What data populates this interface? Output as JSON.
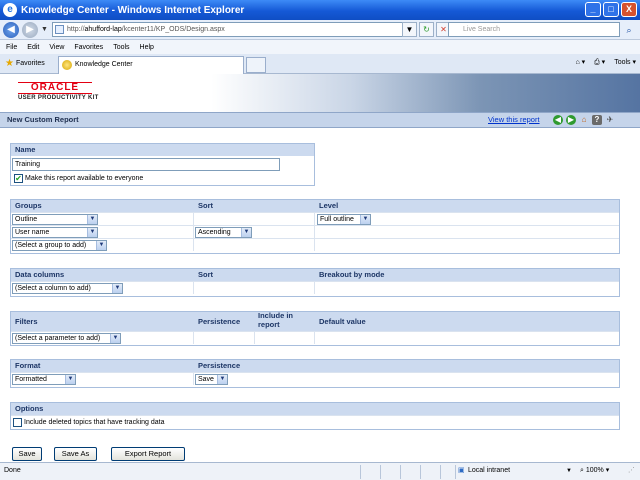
{
  "window": {
    "title": "Knowledge Center - Windows Internet Explorer",
    "controls": {
      "minimize": "_",
      "maximize": "□",
      "close": "X"
    }
  },
  "address_bar": {
    "url_prefix": "http://",
    "url_host": "ahufford-lap",
    "url_path": "/kcenter11/KP_ODS/Design.aspx",
    "search_placeholder": "Live Search"
  },
  "menu": [
    "File",
    "Edit",
    "View",
    "Favorites",
    "Tools",
    "Help"
  ],
  "favorites_bar": {
    "favorites_label": "Favorites",
    "tab_label": "Knowledge Center",
    "tools_label": "Tools"
  },
  "banner": {
    "logo_text": "ORACLE",
    "logo_subtext": "USER PRODUCTIVITY KIT"
  },
  "page_header": {
    "title": "New Custom Report",
    "view_link": "View this report"
  },
  "name_section": {
    "header": "Name",
    "value": "Training",
    "share_label": "Make this report available to everyone",
    "share_checked": true
  },
  "groups_section": {
    "headers": {
      "groups": "Groups",
      "sort": "Sort",
      "level": "Level"
    },
    "row1": {
      "group": "Outline",
      "level": "Full outline"
    },
    "row2": {
      "group": "User name",
      "sort": "Ascending"
    },
    "row3": {
      "group": "(Select a group to add)"
    }
  },
  "columns_section": {
    "headers": {
      "columns": "Data columns",
      "sort": "Sort",
      "breakout": "Breakout by mode"
    },
    "column_select": "(Select a column to add)"
  },
  "filters_section": {
    "headers": {
      "filters": "Filters",
      "persistence": "Persistence",
      "include_line1": "Include in",
      "include_line2": "report",
      "default": "Default value"
    },
    "parameter_select": "(Select a parameter to add)"
  },
  "format_section": {
    "headers": {
      "format": "Format",
      "persistence": "Persistence"
    },
    "format_value": "Formatted",
    "persistence_value": "Save"
  },
  "options_section": {
    "header": "Options",
    "deleted_label": "Include deleted topics that have tracking data",
    "deleted_checked": false
  },
  "buttons": {
    "save": "Save",
    "save_as": "Save As",
    "export": "Export Report"
  },
  "status_bar": {
    "status": "Done",
    "zone": "Local intranet",
    "zoom": "100%"
  }
}
